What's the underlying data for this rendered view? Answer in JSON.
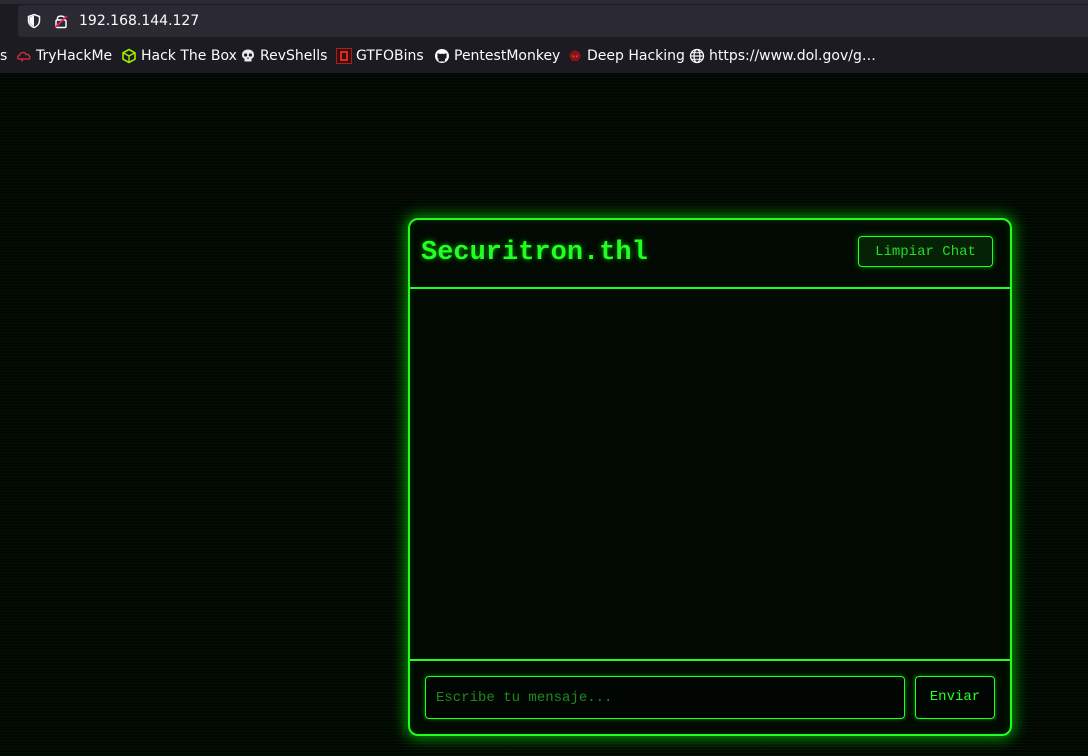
{
  "browser": {
    "url": "192.168.144.127",
    "bookmarks": [
      {
        "label": "s",
        "icon": "bookmark-overflow"
      },
      {
        "label": "TryHackMe",
        "icon": "tryhackme-icon"
      },
      {
        "label": "Hack The Box",
        "icon": "hackthebox-icon"
      },
      {
        "label": "RevShells",
        "icon": "skull-icon"
      },
      {
        "label": "GTFOBins",
        "icon": "gtfobins-icon"
      },
      {
        "label": "PentestMonkey",
        "icon": "github-icon"
      },
      {
        "label": "Deep Hacking",
        "icon": "deephacking-icon"
      },
      {
        "label": "https://www.dol.gov/g…",
        "icon": "globe-icon"
      }
    ]
  },
  "chat": {
    "title": "Securitron.thl",
    "clear_label": "Limpiar Chat",
    "input_placeholder": "Escribe tu mensaje...",
    "input_value": "",
    "send_label": "Enviar",
    "messages": []
  },
  "colors": {
    "accent": "#20ff20",
    "background": "#030603",
    "chrome": "#1c1b22",
    "urlbar": "#2b2a33"
  }
}
